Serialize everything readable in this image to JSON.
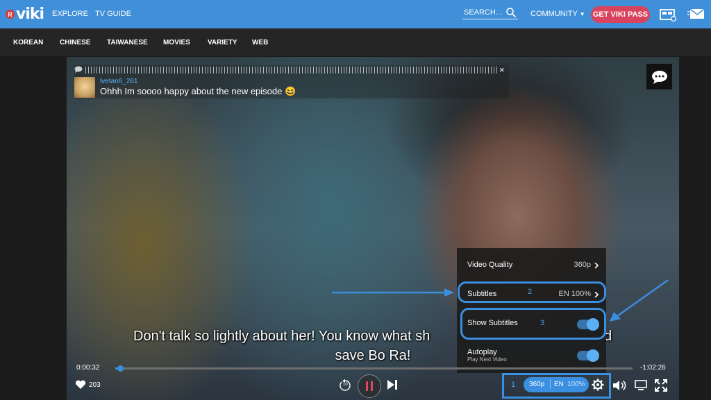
{
  "header": {
    "logo_badge": "R",
    "logo_text": "viki",
    "nav": [
      "EXPLORE",
      "TV GUIDE"
    ],
    "search_placeholder": "SEARCH...",
    "community_label": "COMMUNITY",
    "cta_label": "GET VIKI PASS",
    "icons": [
      "tv-schedule-icon",
      "mail-icon"
    ],
    "colors": {
      "bar": "#3f8fd9",
      "cta": "#d8435d"
    }
  },
  "subnav": [
    "KOREAN",
    "CHINESE",
    "TAIWANESE",
    "MOVIES",
    "VARIETY",
    "WEB"
  ],
  "comment": {
    "close_glyph": "×",
    "username": "lvetan6_261",
    "text": "Ohhh Im soooo happy about the new episode 😆"
  },
  "subtitle": {
    "line1": "Don't talk so lightly about her! You know what sh",
    "line1_tail": "d",
    "line2": "save Bo Ra!"
  },
  "settings_menu": {
    "video_quality_label": "Video Quality",
    "video_quality_value": "360p",
    "subtitles_label": "Subtitles",
    "subtitles_value": "EN 100%",
    "show_subtitles_label": "Show Subtitles",
    "show_subtitles_on": true,
    "autoplay_label": "Autoplay",
    "autoplay_sub": "Play Next Video",
    "autoplay_on": true
  },
  "annotations": {
    "n1": "1",
    "n2": "2",
    "n3": "3",
    "color": "#3a8fe0"
  },
  "controls": {
    "elapsed": "0:00:32",
    "remaining": "-1:02:26",
    "progress_fraction": 0.01,
    "likes": "203",
    "replay_label": "10",
    "quality_pill": "360p",
    "lang_pill": "EN",
    "lang_pct": "100%"
  }
}
